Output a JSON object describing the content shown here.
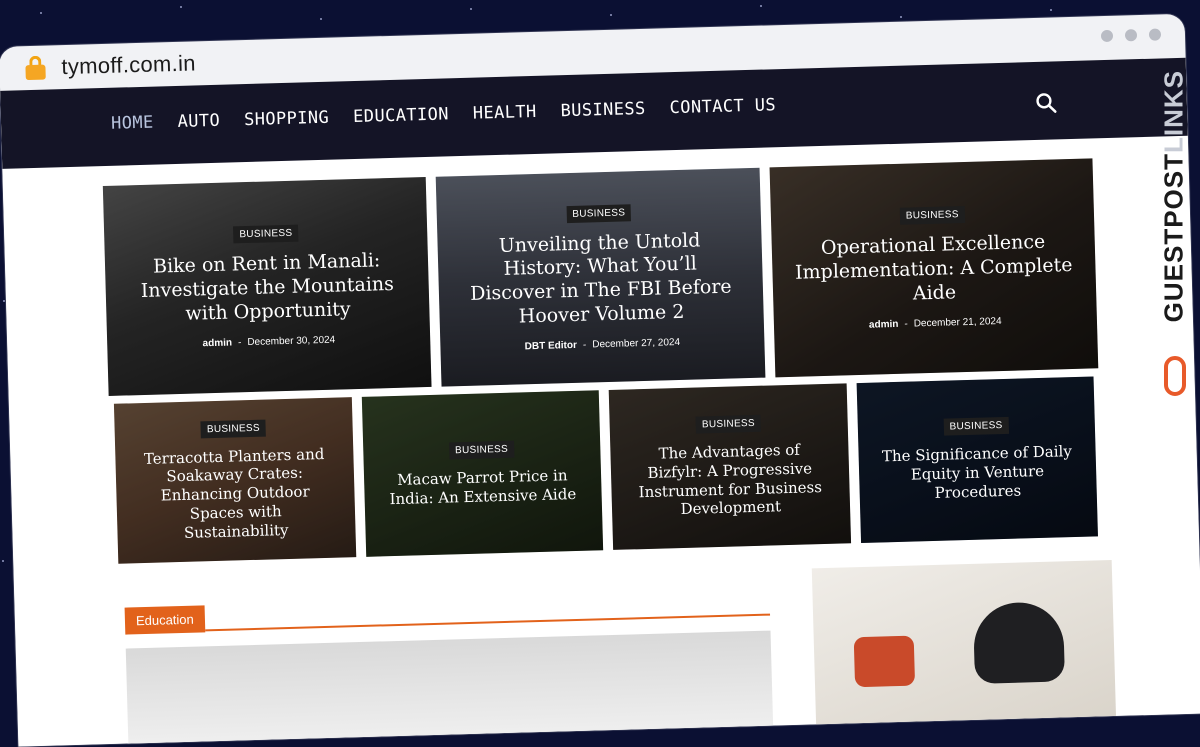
{
  "browser": {
    "url": "tymoff.com.in"
  },
  "nav": {
    "items": [
      {
        "label": "HOME",
        "active": true
      },
      {
        "label": "AUTO",
        "active": false
      },
      {
        "label": "SHOPPING",
        "active": false
      },
      {
        "label": "EDUCATION",
        "active": false
      },
      {
        "label": "HEALTH",
        "active": false
      },
      {
        "label": "BUSINESS",
        "active": false
      },
      {
        "label": "CONTACT US",
        "active": false
      }
    ],
    "search_icon": "search-icon"
  },
  "featured": [
    {
      "category": "BUSINESS",
      "title": "Bike on Rent in Manali: Investigate the Mountains with Opportunity",
      "author": "admin",
      "sep": "-",
      "date": "December 30, 2024"
    },
    {
      "category": "BUSINESS",
      "title": "Unveiling the Untold History: What You’ll Discover in The FBI Before Hoover Volume 2",
      "author": "DBT Editor",
      "sep": "-",
      "date": "December 27, 2024"
    },
    {
      "category": "BUSINESS",
      "title": "Operational Excellence Implementation: A Complete Aide",
      "author": "admin",
      "sep": "-",
      "date": "December 21, 2024"
    }
  ],
  "secondary": [
    {
      "category": "BUSINESS",
      "title": "Terracotta Planters and Soakaway Crates: Enhancing Outdoor Spaces with Sustainability"
    },
    {
      "category": "BUSINESS",
      "title": "Macaw Parrot Price in India: An Extensive Aide"
    },
    {
      "category": "BUSINESS",
      "title": "The Advantages of Bizfylr: A Progressive Instrument for Business Development"
    },
    {
      "category": "BUSINESS",
      "title": "The Significance of Daily Equity in Venture Procedures"
    }
  ],
  "section": {
    "label": "Education"
  },
  "watermark": {
    "text_main": "GUESTPOST",
    "text_accent": "LINKS"
  },
  "colors": {
    "nav_bg": "#141426",
    "accent": "#e2621b",
    "lock": "#f5a623"
  }
}
